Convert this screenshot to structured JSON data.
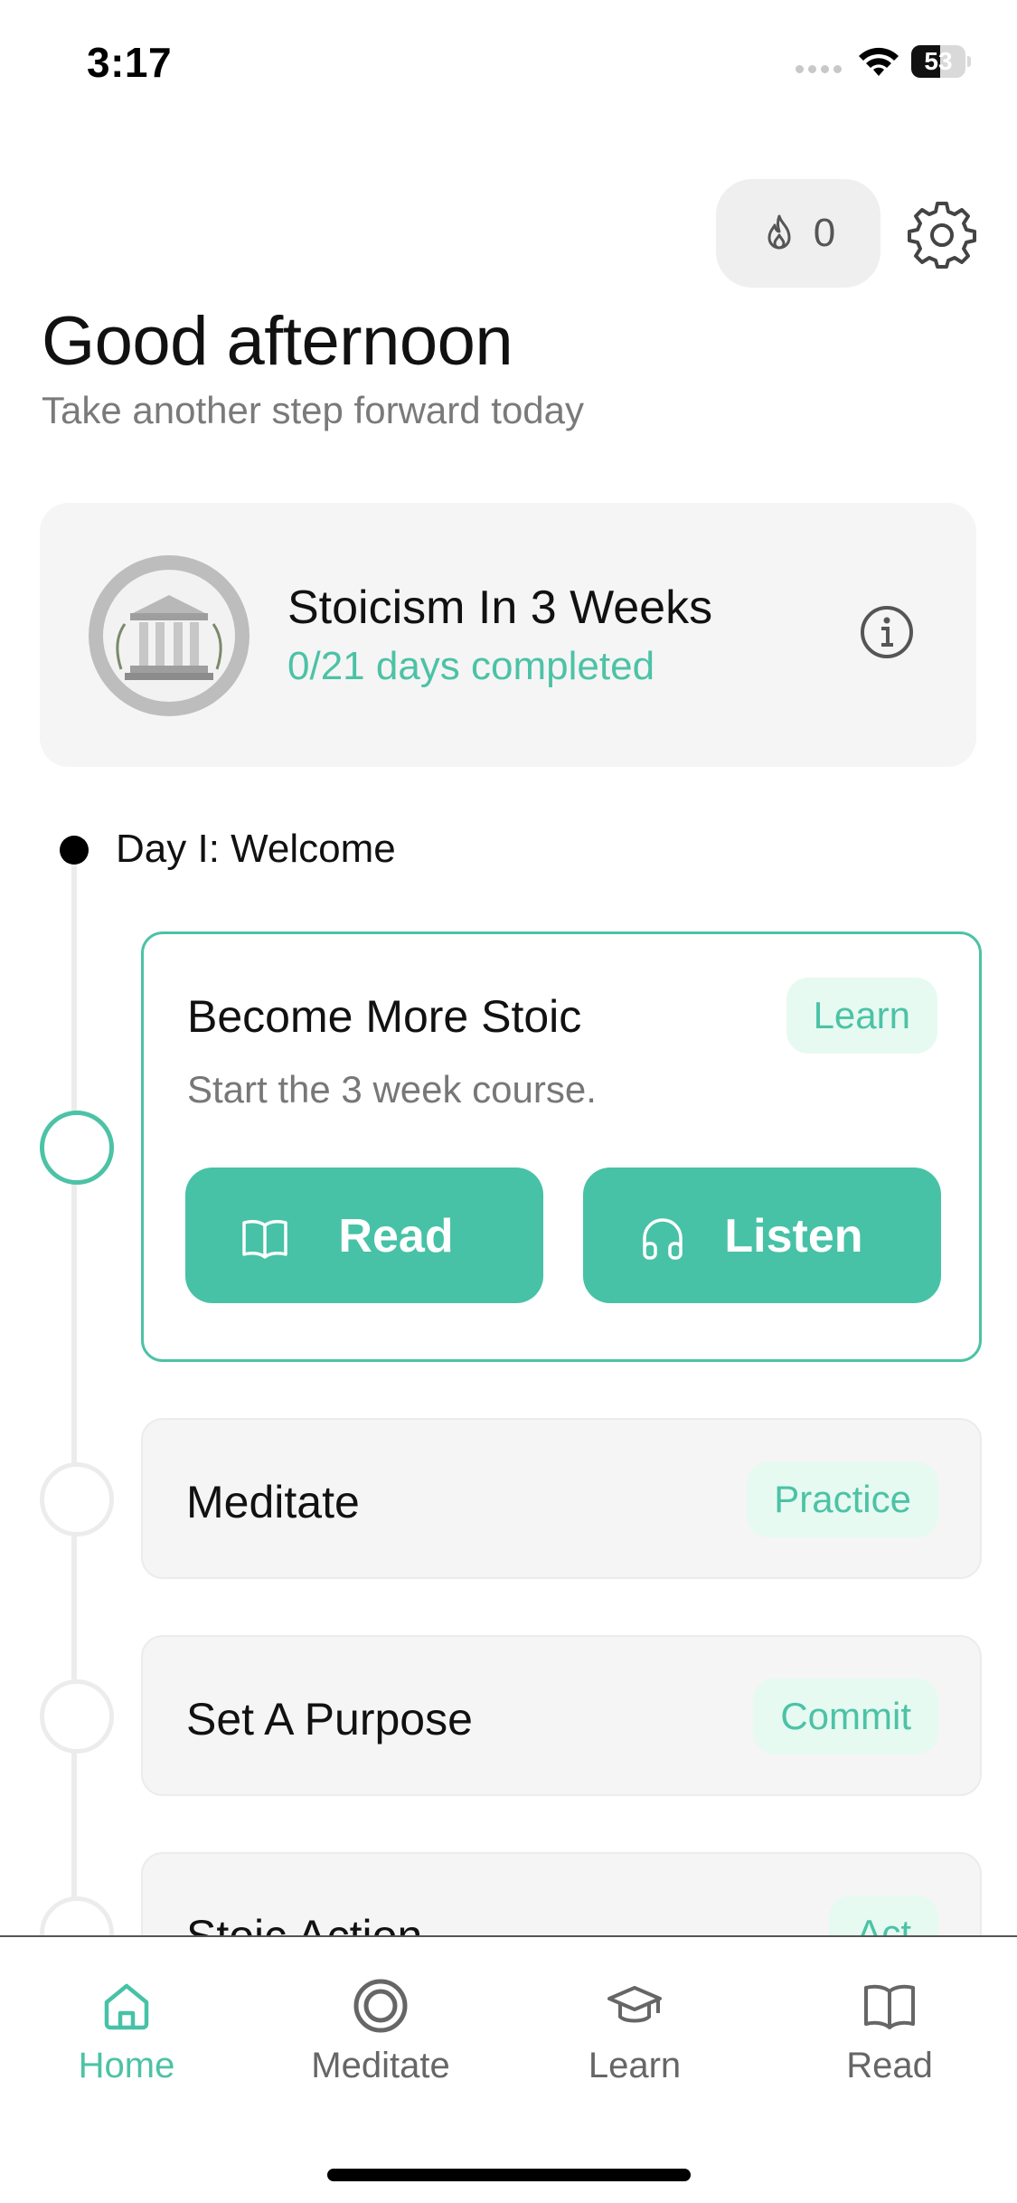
{
  "status_bar": {
    "time": "3:17",
    "battery": "53",
    "battery_level": 0.53
  },
  "header": {
    "streak_count": "0",
    "streak_icon": "flame-icon",
    "settings_icon": "gear-icon"
  },
  "greeting": {
    "title": "Good afternoon",
    "subtitle": "Take another step forward today"
  },
  "course": {
    "title": "Stoicism In 3 Weeks",
    "progress": "0/21 days completed",
    "emblem": "greek-temple-emblem",
    "info_icon": "info-icon"
  },
  "day": {
    "label": "Day I: Welcome"
  },
  "tasks": [
    {
      "title": "Become More Stoic",
      "description": "Start the 3 week course.",
      "tag": "Learn",
      "active": true,
      "actions": [
        {
          "label": "Read",
          "icon": "book-icon"
        },
        {
          "label": "Listen",
          "icon": "headphones-icon"
        }
      ]
    },
    {
      "title": "Meditate",
      "tag": "Practice",
      "active": false
    },
    {
      "title": "Set A Purpose",
      "tag": "Commit",
      "active": false
    },
    {
      "title": "Stoic Action",
      "tag": "Act",
      "active": false
    }
  ],
  "tab_bar": {
    "items": [
      {
        "label": "Home",
        "icon": "home-icon",
        "active": true
      },
      {
        "label": "Meditate",
        "icon": "target-icon",
        "active": false
      },
      {
        "label": "Learn",
        "icon": "graduation-cap-icon",
        "active": false
      },
      {
        "label": "Read",
        "icon": "book-open-icon",
        "active": false
      }
    ]
  },
  "colors": {
    "accent": "#47c2a6",
    "tag_bg": "#e6faf1",
    "card_bg": "#f5f5f5",
    "text_muted": "#7a7a7a"
  }
}
